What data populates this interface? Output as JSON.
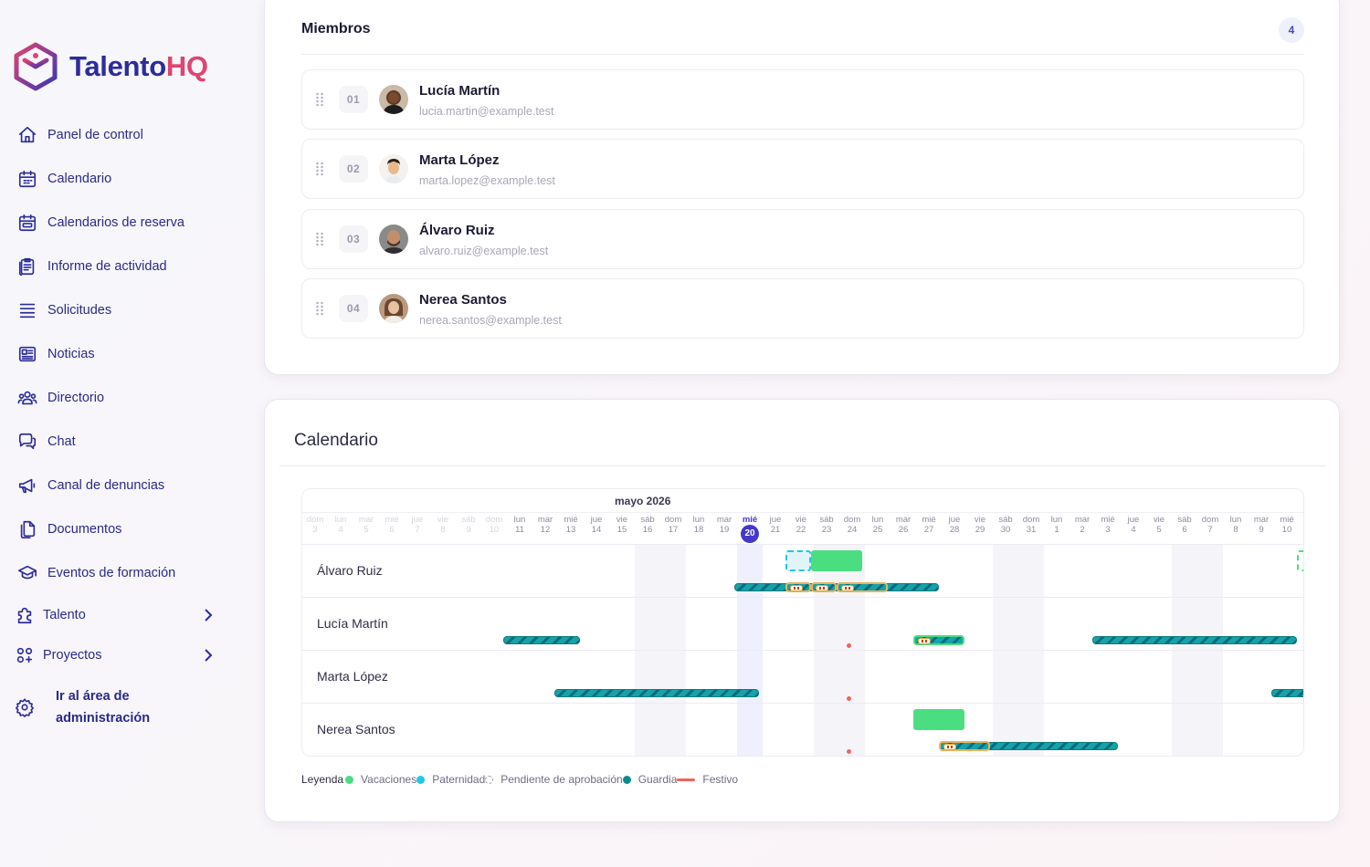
{
  "brand": {
    "name_a": "Talento",
    "name_b": "HQ",
    "colors": {
      "primary": "#2d2c9a",
      "accent": "#e0446f"
    }
  },
  "sidebar": {
    "items": [
      {
        "label": "Panel de control",
        "icon": "home-icon"
      },
      {
        "label": "Calendario",
        "icon": "calendar-icon"
      },
      {
        "label": "Calendarios de reserva",
        "icon": "calendar-booking-icon"
      },
      {
        "label": "Informe de actividad",
        "icon": "report-icon"
      },
      {
        "label": "Solicitudes",
        "icon": "list-icon"
      },
      {
        "label": "Noticias",
        "icon": "newspaper-icon"
      },
      {
        "label": "Directorio",
        "icon": "users-icon"
      },
      {
        "label": "Chat",
        "icon": "chat-icon"
      },
      {
        "label": "Canal de denuncias",
        "icon": "megaphone-icon"
      },
      {
        "label": "Documentos",
        "icon": "documents-icon"
      },
      {
        "label": "Eventos de formación",
        "icon": "graduation-icon"
      },
      {
        "label": "Talento",
        "icon": "puzzle-icon"
      },
      {
        "label": "Proyectos",
        "icon": "grid-icon"
      }
    ],
    "admin": {
      "line1": "Ir al área de",
      "line2": "administración",
      "icon": "gear-icon"
    }
  },
  "members": {
    "title": "Miembros",
    "count": "4",
    "list": [
      {
        "num": "01",
        "name": "Lucía Martín",
        "email": "lucia.martin@example.test"
      },
      {
        "num": "02",
        "name": "Marta López",
        "email": "marta.lopez@example.test"
      },
      {
        "num": "03",
        "name": "Álvaro Ruiz",
        "email": "alvaro.ruiz@example.test"
      },
      {
        "num": "04",
        "name": "Nerea Santos",
        "email": "nerea.santos@example.test"
      }
    ]
  },
  "calendar": {
    "title": "Calendario",
    "month": "mayo 2026",
    "days": [
      {
        "w": "dom",
        "d": "3"
      },
      {
        "w": "lun",
        "d": "4"
      },
      {
        "w": "mar",
        "d": "5"
      },
      {
        "w": "mié",
        "d": "6"
      },
      {
        "w": "jue",
        "d": "7"
      },
      {
        "w": "vie",
        "d": "8"
      },
      {
        "w": "sáb",
        "d": "9"
      },
      {
        "w": "dom",
        "d": "10"
      },
      {
        "w": "lun",
        "d": "11"
      },
      {
        "w": "mar",
        "d": "12"
      },
      {
        "w": "mié",
        "d": "13"
      },
      {
        "w": "jue",
        "d": "14"
      },
      {
        "w": "vie",
        "d": "15"
      },
      {
        "w": "sáb",
        "d": "16"
      },
      {
        "w": "dom",
        "d": "17"
      },
      {
        "w": "lun",
        "d": "18"
      },
      {
        "w": "mar",
        "d": "19"
      },
      {
        "w": "mié",
        "d": "20"
      },
      {
        "w": "jue",
        "d": "21"
      },
      {
        "w": "vie",
        "d": "22"
      },
      {
        "w": "sáb",
        "d": "23"
      },
      {
        "w": "dom",
        "d": "24"
      },
      {
        "w": "lun",
        "d": "25"
      },
      {
        "w": "mar",
        "d": "26"
      },
      {
        "w": "mié",
        "d": "27"
      },
      {
        "w": "jue",
        "d": "28"
      },
      {
        "w": "vie",
        "d": "29"
      },
      {
        "w": "sáb",
        "d": "30"
      },
      {
        "w": "dom",
        "d": "31"
      },
      {
        "w": "lun",
        "d": "1"
      },
      {
        "w": "mar",
        "d": "2"
      },
      {
        "w": "mié",
        "d": "3"
      },
      {
        "w": "jue",
        "d": "4"
      },
      {
        "w": "vie",
        "d": "5"
      },
      {
        "w": "sáb",
        "d": "6"
      },
      {
        "w": "dom",
        "d": "7"
      },
      {
        "w": "lun",
        "d": "8"
      },
      {
        "w": "mar",
        "d": "9"
      },
      {
        "w": "mié",
        "d": "10"
      }
    ],
    "today_index": 17,
    "rows": [
      "Álvaro Ruiz",
      "Lucía Martín",
      "Marta López",
      "Nerea Santos"
    ],
    "legend": {
      "title": "Leyenda",
      "items": [
        {
          "label": "Vacaciones",
          "color": "#4ade80"
        },
        {
          "label": "Paternidad",
          "color": "#22c5e8"
        },
        {
          "label": "Pendiente de aprobación",
          "color": "#9a99ab"
        },
        {
          "label": "Guardia",
          "color": "#0e8a8f"
        },
        {
          "label": "Festivo",
          "color": "#f0645c"
        }
      ]
    }
  }
}
